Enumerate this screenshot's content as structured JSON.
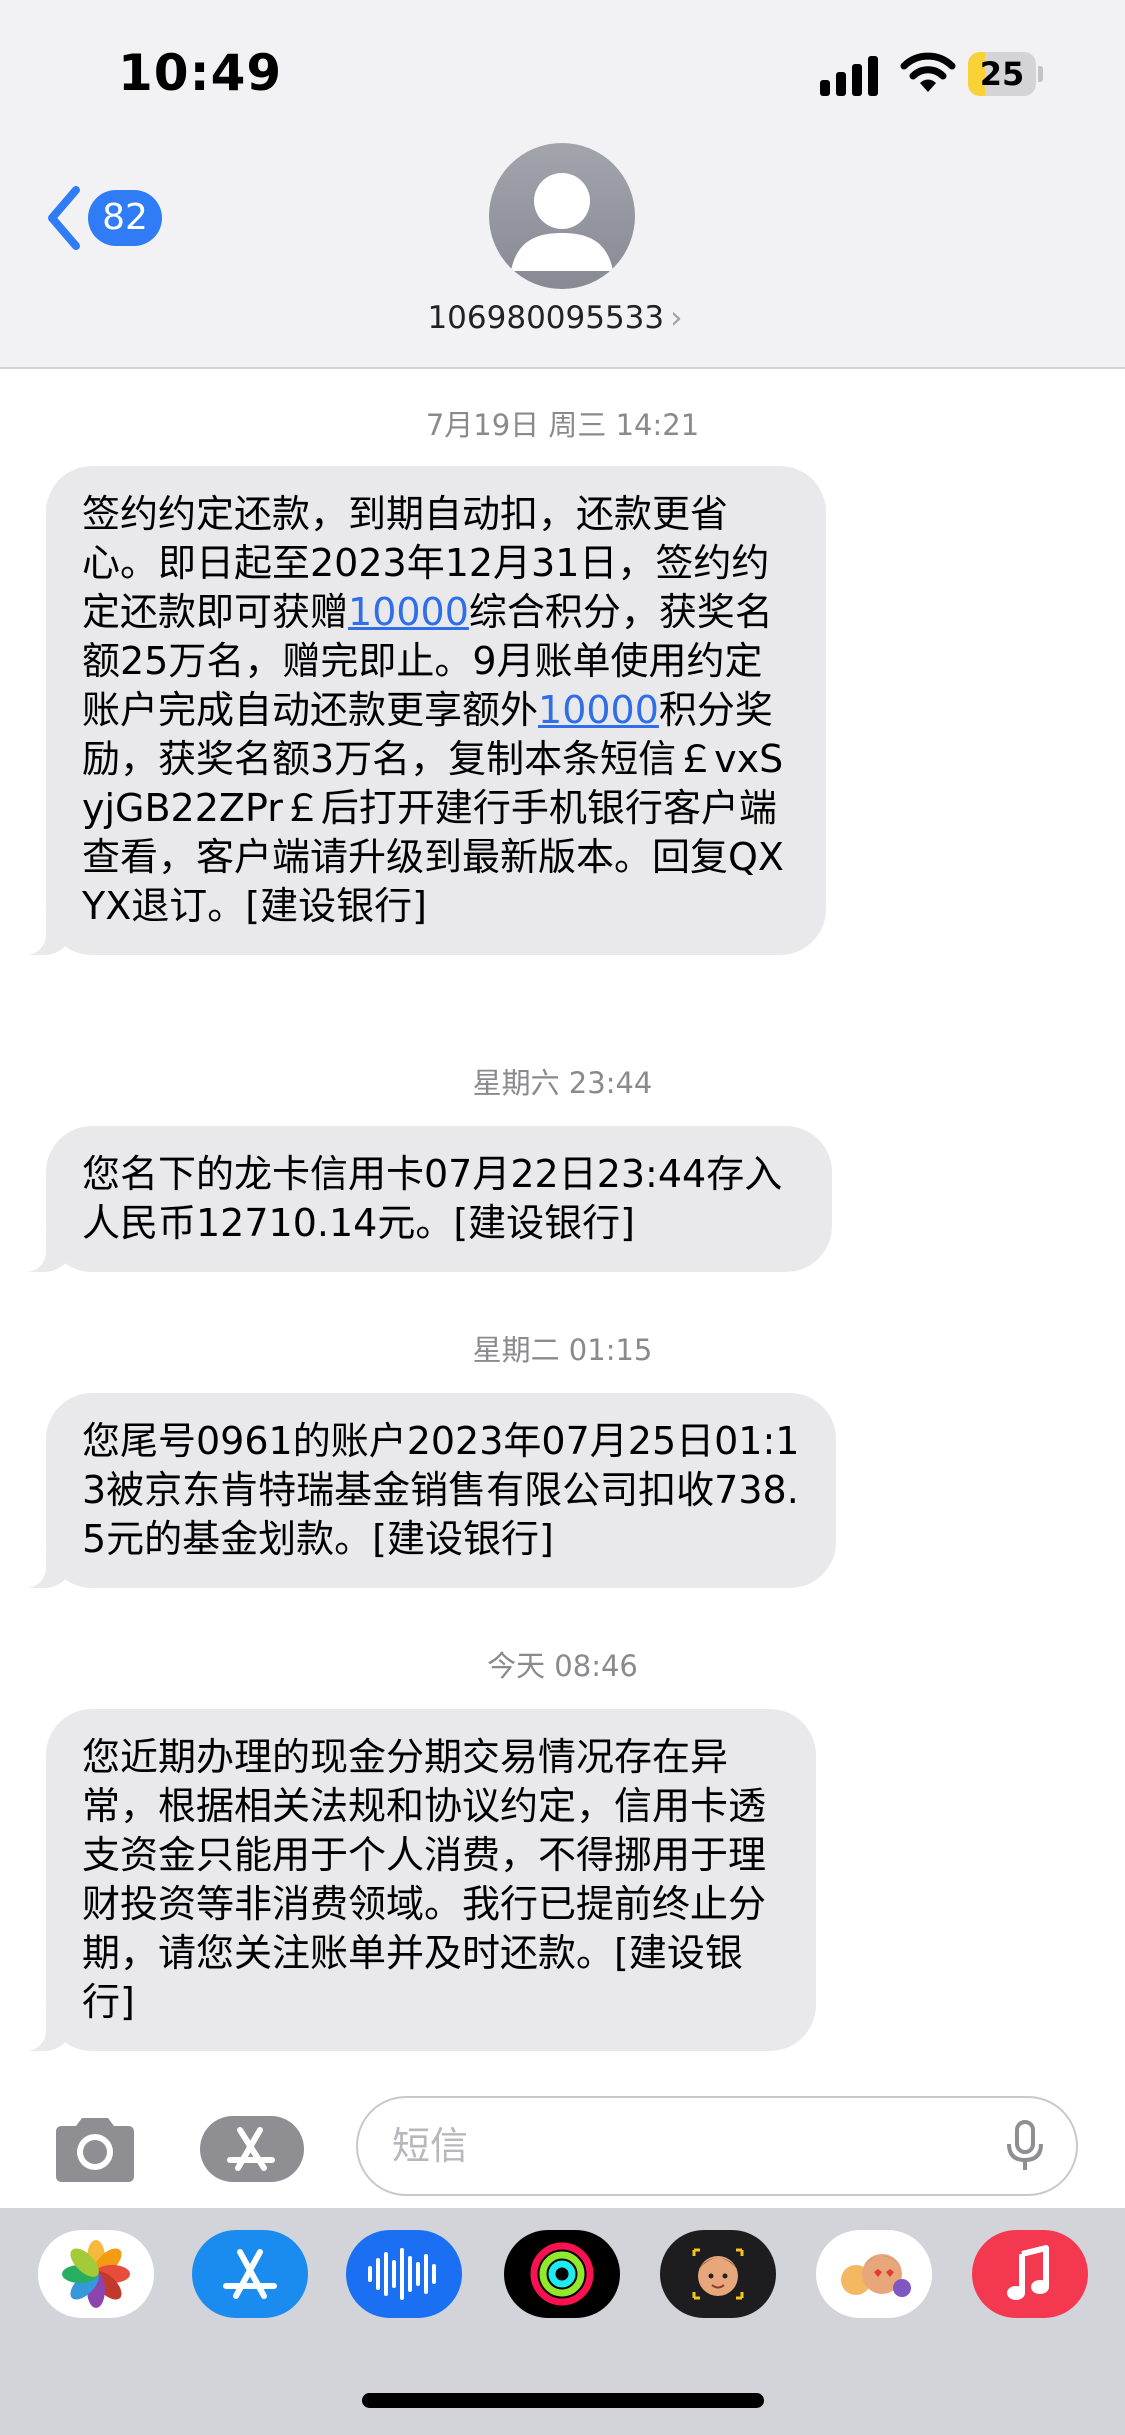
{
  "status_bar": {
    "time": "10:49",
    "battery": "25",
    "battery_level": 0.25
  },
  "nav": {
    "unread_count": "82",
    "contact_number": "106980095533"
  },
  "messages": [
    {
      "timestamp": "7月19日 周三 14:21",
      "text_parts": [
        "签约约定还款，到期自动扣，还款更省心。即日起至2023年12月31日，签约约定还款即可获赠",
        "10000",
        "综合积分，获奖名额25万名，赠完即止。9月账单使用约定账户完成自动还款更享额外",
        "10000",
        "积分奖励，获奖名额3万名，复制本条短信￡vxSyjGB22ZPr￡后打开建行手机银行客户端查看，客户端请升级到最新版本。回复QXYX退订。[建设银行]"
      ]
    },
    {
      "timestamp": "星期六 23:44",
      "text": "您名下的龙卡信用卡07月22日23:44存入人民币12710.14元。[建设银行]"
    },
    {
      "timestamp": "星期二 01:15",
      "text": "您尾号0961的账户2023年07月25日01:13被京东肯特瑞基金销售有限公司扣收738.5元的基金划款。[建设银行]"
    },
    {
      "timestamp": "今天 08:46",
      "text": "您近期办理的现金分期交易情况存在异常，根据相关法规和协议约定，信用卡透支资金只能用于个人消费，不得挪用于理财投资等非消费领域。我行已提前终止分期，请您关注账单并及时还款。[建设银行]"
    }
  ],
  "compose": {
    "placeholder": "短信"
  },
  "app_strip": [
    "photos-app-icon",
    "app-store-app-icon",
    "audio-messages-app-icon",
    "fitness-app-icon",
    "memoji-app-icon",
    "memoji-stickers-app-icon",
    "music-app-icon"
  ]
}
